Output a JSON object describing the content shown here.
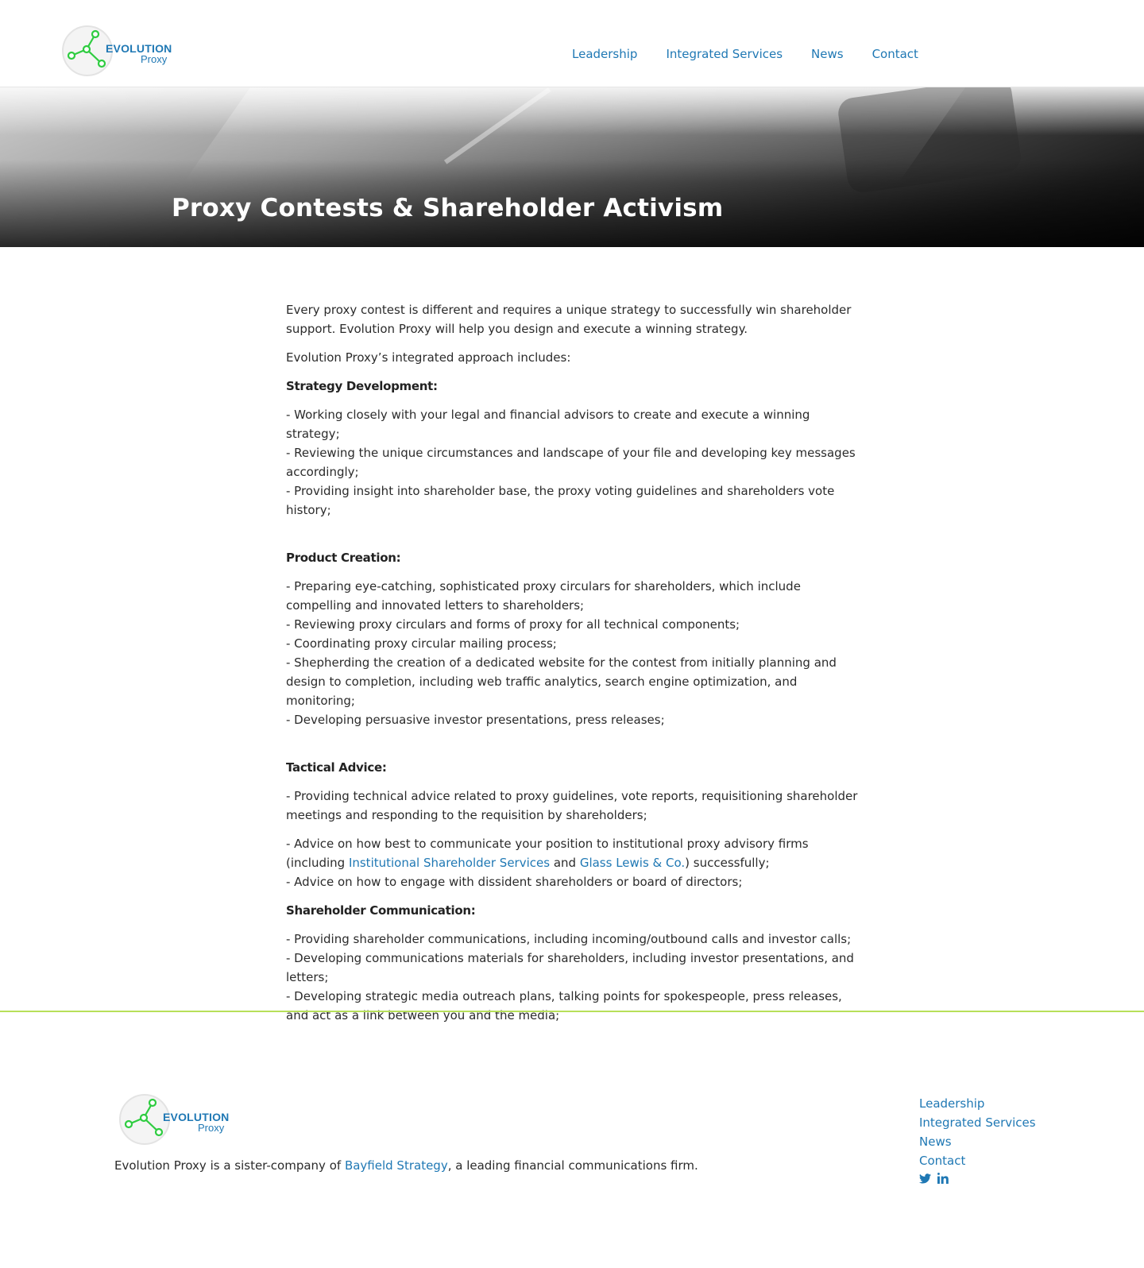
{
  "brand": {
    "logo_word_top": "EVOLUTION",
    "logo_word_bottom": "Proxy",
    "logo_colors": {
      "network": "#2ecc40",
      "text": "#1f78b4"
    }
  },
  "header": {
    "nav": [
      {
        "label": "Leadership"
      },
      {
        "label": "Integrated Services"
      },
      {
        "label": "News"
      },
      {
        "label": "Contact"
      }
    ]
  },
  "hero": {
    "title": "Proxy Contests & Shareholder Activism"
  },
  "content": {
    "intro": "Every proxy contest is different and requires a unique strategy to successfully win shareholder support. Evolution Proxy will help you design and execute a winning strategy.",
    "approach": "Evolution Proxy’s integrated approach includes:",
    "strategy": {
      "heading": "Strategy Development:",
      "items": [
        "- Working closely with your legal and financial advisors to create and execute a winning strategy;",
        "- Reviewing the unique circumstances and landscape of your file and developing key messages accordingly;",
        "- Providing insight into shareholder base, the proxy voting guidelines and shareholders vote history;"
      ]
    },
    "product": {
      "heading": "Product Creation:",
      "items": [
        "- Preparing eye-catching, sophisticated proxy circulars for shareholders, which include compelling and innovated letters to shareholders;",
        "- Reviewing proxy circulars and forms of proxy for all technical components;",
        "- Coordinating proxy circular mailing process;",
        "- Shepherding the creation of a dedicated website for the contest from initially planning and design to completion, including web traffic analytics, search engine optimization, and monitoring;",
        "- Developing persuasive investor presentations, press releases;"
      ]
    },
    "tactical": {
      "heading": "Tactical Advice:",
      "item1": "- Providing technical advice related to proxy guidelines, vote reports, requisitioning shareholder meetings and responding to the requisition by shareholders;",
      "item2_pre": "- Advice on how best to communicate your position to institutional proxy advisory firms (including ",
      "item2_link1": "Institutional Shareholder Services",
      "item2_mid": " and ",
      "item2_link2": "Glass Lewis & Co.",
      "item2_post": ") successfully;",
      "item3": "- Advice on how to engage with dissident shareholders or board of directors;"
    },
    "communication": {
      "heading": "Shareholder Communication:",
      "items": [
        "- Providing shareholder communications, including incoming/outbound calls and investor calls;",
        "- Developing communications materials for shareholders, including investor presentations, and letters;",
        "- Developing strategic media outreach plans, talking points for spokespeople, press releases, and act as a link between you and the media;"
      ]
    }
  },
  "footer": {
    "text_pre": "Evolution Proxy is a sister-company of ",
    "text_link": "Bayfield Strategy",
    "text_post": ", a leading financial communications firm.",
    "nav": [
      {
        "label": "Leadership"
      },
      {
        "label": "Integrated Services"
      },
      {
        "label": "News"
      },
      {
        "label": "Contact"
      }
    ],
    "social": [
      {
        "icon": "twitter-icon"
      },
      {
        "icon": "linkedin-icon"
      }
    ],
    "rule_color": "#b7e05a"
  }
}
